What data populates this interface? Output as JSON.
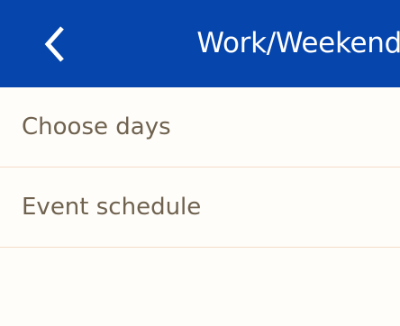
{
  "header": {
    "title": "Work/Weekend",
    "back_icon": "chevron-left-icon"
  },
  "menu": {
    "items": [
      {
        "label": "Choose days"
      },
      {
        "label": "Event schedule"
      }
    ]
  },
  "colors": {
    "header_background": "#0545ac",
    "header_text": "#ffffff",
    "page_background": "#fffdfa",
    "item_text": "#6f624f",
    "divider": "#f3dcc9"
  }
}
